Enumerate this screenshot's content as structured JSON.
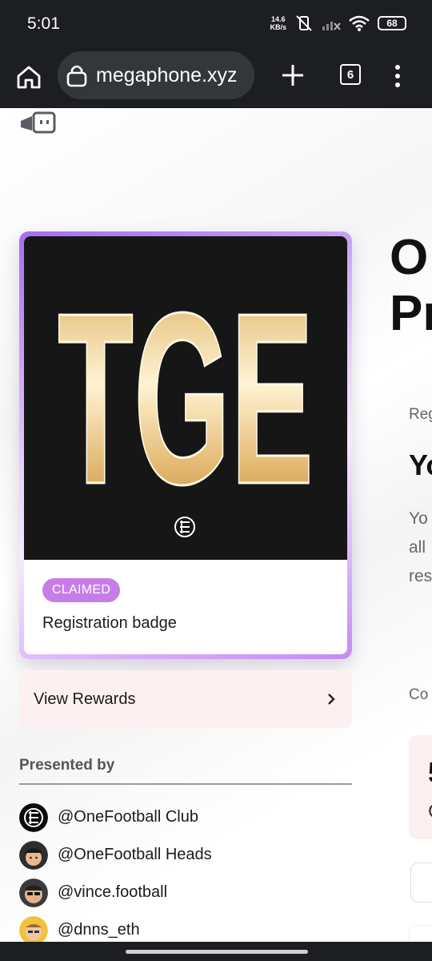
{
  "status_bar": {
    "time": "5:01",
    "net_speed_value": "14.6",
    "net_speed_unit": "KB/s",
    "battery": "68",
    "icons": [
      "mute-vibrate-icon",
      "signal-off-icon",
      "wifi-icon",
      "battery-icon"
    ]
  },
  "browser": {
    "url": "megaphone.xyz",
    "tab_count": "6",
    "icons": [
      "home-icon",
      "lock-icon",
      "plus-icon",
      "tabs-icon",
      "menu-dots-icon"
    ]
  },
  "badge_card": {
    "image_text": "TGE",
    "status": "CLAIMED",
    "name": "Registration badge",
    "colors": {
      "border_start": "#a66cf0",
      "border_end": "#c58af2",
      "claimed_bg": "#c77de8",
      "image_bg": "#161616",
      "gold_light": "#fff3d3",
      "gold_dark": "#c8963f"
    }
  },
  "rewards": {
    "label": "View Rewards"
  },
  "presented": {
    "heading": "Presented by",
    "presenters": [
      {
        "name": "@OneFootball Club",
        "avatar": "onefootball-club-logo"
      },
      {
        "name": "@OneFootball Heads",
        "avatar": "cap-avatar"
      },
      {
        "name": "@vince.football",
        "avatar": "sunglasses-avatar"
      },
      {
        "name": "@dnns_eth",
        "avatar": "yellow-avatar"
      }
    ]
  },
  "right_column": {
    "title_line1": "O",
    "title_line2": "Pr",
    "reg_label": "Reg",
    "heading": "Yo",
    "desc_line1": "Yo",
    "desc_line2": "all",
    "desc_line3": "res",
    "co_label": "Co",
    "stat_number": "5",
    "stat_sub": "C"
  }
}
